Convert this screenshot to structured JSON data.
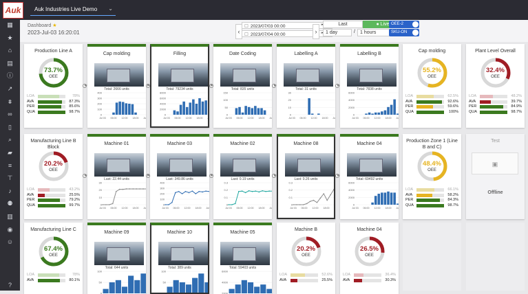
{
  "app": {
    "logo": "Auk",
    "tenant": "Auk Industries Live Demo"
  },
  "header": {
    "breadcrumb": "Dashboard",
    "datetime": "2023-Jul-03 16:20:01",
    "date_from": "2023/07/03 00:00",
    "date_to": "2023/07/04 00:00",
    "last_label": "Last",
    "live_label": "Live",
    "period_days": "1 day",
    "period_sep": "/",
    "period_hours": "1 hours",
    "toggle1": "OEE-2",
    "toggle2": "SKU-ON"
  },
  "sidebar_icons": [
    "grid-icon",
    "star-icon",
    "factory-icon",
    "table-icon",
    "info-icon",
    "line-chart-icon",
    "filter-icon",
    "link-icon",
    "document-icon",
    "search-icon",
    "folder-icon",
    "list-icon",
    "network-icon",
    "bell-icon",
    "users-icon",
    "columns-icon",
    "palette-icon",
    "user-icon",
    "help-icon"
  ],
  "colors": {
    "green": "#3b7a1f",
    "yellow": "#e6b422",
    "red": "#a01c24",
    "blue": "#2f6db3",
    "teal": "#1ea7a0",
    "grey": "#8c8c8c"
  },
  "cards": [
    {
      "id": "production-line-a",
      "type": "gauge",
      "title": "Production Line A",
      "oee": "73.7%",
      "oee_value": 73.7,
      "color": "green",
      "metrics": [
        {
          "k": "LOA",
          "v": "78%",
          "f": 0.78,
          "c": "#c9dfb8",
          "faded": true
        },
        {
          "k": "AVA",
          "v": "87.3%",
          "f": 0.87,
          "c": "#3b7a1f"
        },
        {
          "k": "PER",
          "v": "85.6%",
          "f": 0.86,
          "c": "#3b7a1f"
        },
        {
          "k": "QUA",
          "v": "98.7%",
          "f": 0.99,
          "c": "#3b7a1f"
        }
      ]
    },
    {
      "id": "cap-molding-1",
      "type": "chart",
      "title": "Cap molding",
      "caption": "Total: 2666 units",
      "chart": "bar",
      "bars": [
        0,
        0,
        0,
        0.1,
        0.55,
        0.6,
        0.58,
        0.52,
        0.5,
        0.48,
        0.1,
        0,
        0,
        0
      ],
      "ylabels": [
        "400",
        "300",
        "200",
        "100",
        "0"
      ],
      "xlabels": [
        "Jul 03",
        "06:00",
        "12:00",
        "18:00",
        "Jul 04"
      ]
    },
    {
      "id": "filling",
      "type": "chart",
      "title": "Filling",
      "caption": "Total: 79234 units",
      "chart": "bar",
      "bars": [
        0,
        0,
        0.2,
        0.15,
        0.45,
        0.6,
        0.35,
        0.55,
        0.7,
        0.5,
        0.75,
        0.6,
        0.65,
        0
      ],
      "ylabels": [
        "8000",
        "6000",
        "4000",
        "2000",
        "0"
      ],
      "xlabels": [
        "Jul 03",
        "06:00",
        "12:00",
        "18:00",
        "Jul 04"
      ]
    },
    {
      "id": "date-coding",
      "type": "chart",
      "title": "Date Coding",
      "caption": "Total: 835 units",
      "chart": "bar",
      "bars": [
        0,
        0,
        0.3,
        0.35,
        0.1,
        0.4,
        0.35,
        0.3,
        0.4,
        0.3,
        0.3,
        0.2,
        0,
        0
      ],
      "ylabels": [
        "150",
        "100",
        "50",
        "0"
      ],
      "xlabels": [
        "Jul 03",
        "06:00",
        "12:00",
        "18:00",
        "Jul 04"
      ]
    },
    {
      "id": "labelling-a",
      "type": "chart",
      "title": "Labelling A",
      "caption": "Total: 31 units",
      "chart": "bar",
      "bars": [
        0,
        0,
        0,
        0,
        0,
        0.75,
        0.05,
        0,
        0.05,
        0,
        0,
        0,
        0,
        0
      ],
      "ylabels": [
        "30",
        "20",
        "10",
        "0"
      ],
      "xlabels": [
        "Jul 03",
        "06:00",
        "12:00",
        "18:00",
        "Jul 04"
      ]
    },
    {
      "id": "labelling-b",
      "type": "chart",
      "title": "Labelling B",
      "caption": "Total: 7838 units",
      "chart": "bar",
      "bars": [
        0,
        0,
        0,
        0.05,
        0.1,
        0.05,
        0.1,
        0.1,
        0.15,
        0.2,
        0.35,
        0.45,
        0.7,
        0.05
      ],
      "ylabels": [
        "6000",
        "4000",
        "2000",
        "0"
      ],
      "xlabels": [
        "Jul 03",
        "06:00",
        "12:00",
        "18:00",
        "Jul 04"
      ]
    },
    {
      "id": "cap-molding-2",
      "type": "gauge",
      "title": "Cap molding",
      "oee": "55.2%",
      "oee_value": 55.2,
      "color": "yellow",
      "metrics": [
        {
          "k": "LOA",
          "v": "62.5%",
          "f": 0.62,
          "c": "#e8dca0",
          "faded": true
        },
        {
          "k": "AVA",
          "v": "92.6%",
          "f": 0.93,
          "c": "#3b7a1f"
        },
        {
          "k": "PER",
          "v": "59.6%",
          "f": 0.6,
          "c": "#e6b422"
        },
        {
          "k": "QUA",
          "v": "100%",
          "f": 1.0,
          "c": "#3b7a1f"
        }
      ]
    },
    {
      "id": "plant-level-overall",
      "type": "gauge",
      "title": "Plant Level Overall",
      "oee": "32.4%",
      "oee_value": 32.4,
      "color": "red",
      "metrics": [
        {
          "k": "LOA",
          "v": "48.2%",
          "f": 0.48,
          "c": "#e6b9bc",
          "faded": true
        },
        {
          "k": "AVA",
          "v": "39.7%",
          "f": 0.4,
          "c": "#a01c24"
        },
        {
          "k": "PER",
          "v": "84.9%",
          "f": 0.85,
          "c": "#3b7a1f"
        },
        {
          "k": "QUA",
          "v": "98.7%",
          "f": 0.99,
          "c": "#3b7a1f"
        }
      ]
    },
    {
      "id": "manufacturing-line-b",
      "type": "gauge",
      "title": "Manufacturing Line B Block",
      "oee": "20.2%",
      "oee_value": 20.2,
      "color": "red",
      "metrics": [
        {
          "k": "LOA",
          "v": "43.2%",
          "f": 0.43,
          "c": "#e6b9bc",
          "faded": true
        },
        {
          "k": "AVA",
          "v": "25.5%",
          "f": 0.26,
          "c": "#a01c24"
        },
        {
          "k": "PER",
          "v": "79.2%",
          "f": 0.79,
          "c": "#3b7a1f"
        },
        {
          "k": "QUA",
          "v": "99.7%",
          "f": 1.0,
          "c": "#3b7a1f"
        }
      ]
    },
    {
      "id": "machine-01",
      "type": "chart",
      "title": "Machine 01",
      "caption": "Last: 22.44 units",
      "chart": "line",
      "line_color": "grey",
      "points": [
        0,
        0,
        0,
        0.05,
        0.6,
        0.7,
        0.7,
        0.72,
        0.72,
        0.72,
        0.72,
        0.72,
        0.72,
        0.72
      ],
      "ylabels": [
        "30",
        "20",
        "10",
        "0"
      ],
      "xlabels": [
        "Jul 03",
        "06:00",
        "12:00",
        "18:00",
        "Jul 04"
      ]
    },
    {
      "id": "machine-03",
      "type": "chart",
      "title": "Machine 03",
      "caption": "Last: 349.86 units",
      "chart": "line",
      "line_color": "blue",
      "points": [
        0,
        0,
        0.1,
        0.55,
        0.6,
        0.5,
        0.6,
        0.55,
        0.62,
        0.5,
        0.6,
        0.58,
        0.62,
        0.6
      ],
      "ylabels": [
        "400",
        "300",
        "200",
        "100",
        "0"
      ],
      "xlabels": [
        "Jul 03",
        "06:00",
        "12:00",
        "18:00",
        "Jul 04"
      ]
    },
    {
      "id": "machine-02",
      "type": "chart",
      "title": "Machine 02",
      "caption": "Last: 0.19 units",
      "chart": "line",
      "line_color": "teal",
      "points": [
        0,
        0,
        0.05,
        0.6,
        0.62,
        0.55,
        0.63,
        0.6,
        0.62,
        0.58,
        0.63,
        0.6,
        0.62,
        0.62
      ],
      "ylabels": [
        "0.3",
        "0.2",
        "0.1",
        "0"
      ],
      "xlabels": [
        "Jul 03",
        "06:00",
        "12:00",
        "18:00",
        "Jul 04"
      ]
    },
    {
      "id": "machine-08",
      "type": "chart",
      "title": "Machine 08",
      "caption": "Last: 0.26 units",
      "chart": "line",
      "line_color": "grey",
      "points": [
        0,
        0,
        0,
        0,
        0.05,
        0.15,
        0.2,
        0.1,
        0.3,
        0.5,
        0.2,
        0.45,
        0.7,
        0.75
      ],
      "ylabels": [
        "0.3",
        "0.2",
        "0.1",
        "0"
      ],
      "xlabels": [
        "Jul 03",
        "06:00",
        "12:00",
        "18:00",
        "Jul 04"
      ]
    },
    {
      "id": "machine-04-a",
      "type": "chart",
      "title": "Machine 04",
      "caption": "Total: 69492 units",
      "chart": "bar",
      "bars": [
        0,
        0,
        0,
        0,
        0,
        0.1,
        0.4,
        0.5,
        0.55,
        0.55,
        0.6,
        0.55,
        0.55,
        0.05
      ],
      "ylabels": [
        "6000",
        "4000",
        "2000",
        "0"
      ],
      "xlabels": [
        "Jul 03",
        "06:00",
        "12:00",
        "18:00",
        "Jul 04"
      ]
    },
    {
      "id": "production-zone-1",
      "type": "gauge",
      "title": "Production Zone 1 (Line B and C)",
      "oee": "48.4%",
      "oee_value": 48.4,
      "color": "yellow",
      "metrics": [
        {
          "k": "LOA",
          "v": "66.1%",
          "f": 0.66,
          "c": "#e8dca0",
          "faded": true
        },
        {
          "k": "AVA",
          "v": "58.2%",
          "f": 0.58,
          "c": "#e6b422"
        },
        {
          "k": "PER",
          "v": "84.3%",
          "f": 0.84,
          "c": "#3b7a1f"
        },
        {
          "k": "QUA",
          "v": "98.7%",
          "f": 0.99,
          "c": "#3b7a1f"
        }
      ]
    },
    {
      "id": "test",
      "type": "offline",
      "title": "Test",
      "status": "Offline"
    },
    {
      "id": "manufacturing-line-c",
      "type": "gauge",
      "title": "Manufacturing Line C",
      "oee": "67.4%",
      "oee_value": 67.4,
      "color": "green",
      "metrics": [
        {
          "k": "LOA",
          "v": "78%",
          "f": 0.78,
          "c": "#c9dfb8",
          "faded": true
        },
        {
          "k": "AVA",
          "v": "80.1%",
          "f": 0.8,
          "c": "#3b7a1f"
        }
      ]
    },
    {
      "id": "machine-09",
      "type": "chart",
      "title": "Machine 09",
      "caption": "Total: 644 units",
      "chart": "bar",
      "bars": [
        0.2,
        0.5,
        0.6,
        0.3,
        0.8,
        0.6,
        0.9
      ],
      "ylabels": [
        "100",
        "50",
        "0"
      ],
      "xlabels": []
    },
    {
      "id": "machine-10",
      "type": "chart",
      "title": "Machine 10",
      "caption": "Total: 389 units",
      "chart": "bar",
      "bars": [
        0.3,
        0.6,
        0.5,
        0.4,
        0.7,
        0.9,
        0.5
      ],
      "ylabels": [
        "100",
        "50",
        "0"
      ],
      "xlabels": []
    },
    {
      "id": "machine-05",
      "type": "chart",
      "title": "Machine 05",
      "caption": "Total: 59403 units",
      "chart": "bar",
      "bars": [
        0.2,
        0.4,
        0.6,
        0.5,
        0.3,
        0.4,
        0.2
      ],
      "ylabels": [
        "6000",
        "4000",
        "2000"
      ],
      "xlabels": []
    },
    {
      "id": "machine-b",
      "type": "gauge",
      "title": "Machine B",
      "oee": "20.2%",
      "oee_value": 20.2,
      "color": "red",
      "metrics": [
        {
          "k": "LOA",
          "v": "52.6%",
          "f": 0.53,
          "c": "#e8dca0",
          "faded": true
        },
        {
          "k": "AVA",
          "v": "25.5%",
          "f": 0.26,
          "c": "#a01c24"
        }
      ]
    },
    {
      "id": "machine-04-b",
      "type": "gauge",
      "title": "Machine 04",
      "oee": "26.5%",
      "oee_value": 26.5,
      "color": "red",
      "metrics": [
        {
          "k": "LOA",
          "v": "36.4%",
          "f": 0.36,
          "c": "#e6b9bc",
          "faded": true
        },
        {
          "k": "AVA",
          "v": "30.3%",
          "f": 0.3,
          "c": "#a01c24"
        }
      ]
    }
  ]
}
